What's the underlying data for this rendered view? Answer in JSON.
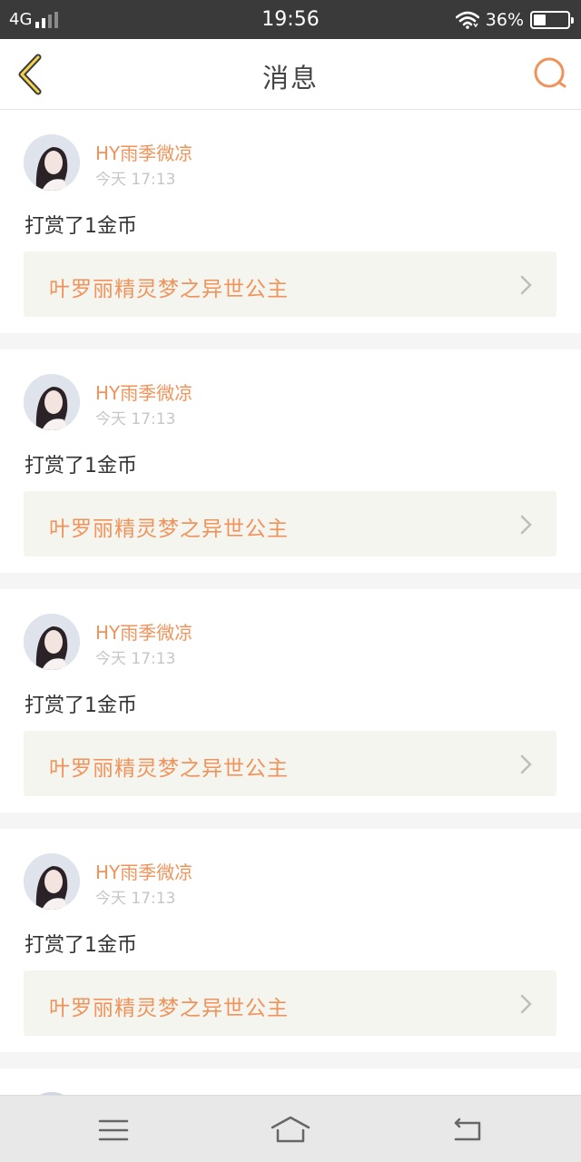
{
  "status_bar": {
    "network": "4G",
    "time": "19:56",
    "battery": "36%",
    "battery_level": 0.36
  },
  "header": {
    "title": "消息",
    "back_icon": "chevron-left-icon",
    "search_icon": "search-icon"
  },
  "accent_color": "#f0935a",
  "messages": [
    {
      "user": "HY雨季微凉",
      "time": "今天 17:13",
      "content": "打赏了1金币",
      "book_title": "叶罗丽精灵梦之异世公主"
    },
    {
      "user": "HY雨季微凉",
      "time": "今天 17:13",
      "content": "打赏了1金币",
      "book_title": "叶罗丽精灵梦之异世公主"
    },
    {
      "user": "HY雨季微凉",
      "time": "今天 17:13",
      "content": "打赏了1金币",
      "book_title": "叶罗丽精灵梦之异世公主"
    },
    {
      "user": "HY雨季微凉",
      "time": "今天 17:13",
      "content": "打赏了1金币",
      "book_title": "叶罗丽精灵梦之异世公主"
    }
  ],
  "nav_bar": {
    "menu_icon": "menu-icon",
    "home_icon": "home-icon",
    "back_icon": "return-icon"
  }
}
